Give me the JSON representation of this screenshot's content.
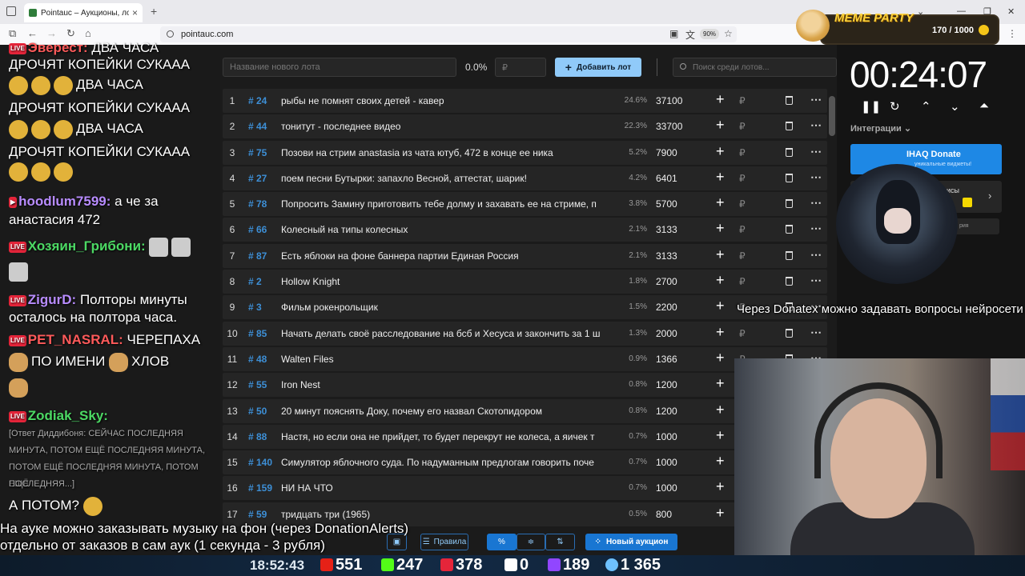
{
  "browser": {
    "tab_title": "Pointauc – Аукционы, лотереи",
    "url": "pointauc.com",
    "zoom": "90%"
  },
  "meme_party": {
    "title": "MEME PARTY",
    "count": "170 / 1000"
  },
  "chat": {
    "messages": [
      {
        "user": "Эверест:",
        "text": "ДВА ЧАСА"
      },
      {
        "text": "ДРОЧЯТ КОПЕЙКИ СУКААА"
      },
      {
        "text": "ДВА ЧАСА"
      },
      {
        "text": "ДРОЧЯТ КОПЕЙКИ СУКААА"
      },
      {
        "text": "ДВА ЧАСА"
      },
      {
        "text": "ДРОЧЯТ КОПЕЙКИ СУКААА"
      },
      {
        "user": "hoodlum7599:",
        "text": "а че за"
      },
      {
        "text": "анастасия 472"
      },
      {
        "user": "Хозяин_Грибони:"
      },
      {
        "user": "ZigurD:",
        "text": "Полторы минуты"
      },
      {
        "text": "осталось на полтора часа."
      },
      {
        "user": "PET_NASRAL:",
        "text": "ЧЕРЕПАХА"
      },
      {
        "text": "ПО ИМЕНИ"
      },
      {
        "text": "ХЛОВ"
      },
      {
        "user": "Zodiak_Sky:"
      },
      {
        "text": "[Ответ Диддибоня: СЕЙЧАС ПОСЛЕДНЯЯ"
      },
      {
        "text": "МИНУТА, ПОТОМ ЕЩЁ ПОСЛЕДНЯЯ МИНУТА,"
      },
      {
        "text": "ПОТОМ ЕЩЁ ПОСЛЕДНЯЯ МИНУТА, ПОТОМ ЕЩЁ"
      },
      {
        "text": "ПОСЛЕДНЯЯ...]"
      },
      {
        "text": "А ПОТОМ?"
      }
    ]
  },
  "auction": {
    "new_lot_placeholder": "Название нового лота",
    "percent": "0.0%",
    "rub_placeholder": "₽",
    "add_label": "Добавить лот",
    "search_placeholder": "Поиск среди лотов...",
    "lots": [
      {
        "n": "1",
        "id": "# 24",
        "name": "рыбы не помнят своих детей - кавер",
        "pct": "24.6%",
        "amount": "37100"
      },
      {
        "n": "2",
        "id": "# 44",
        "name": "тонитут - последнее видео",
        "pct": "22.3%",
        "amount": "33700"
      },
      {
        "n": "3",
        "id": "# 75",
        "name": "Позови на стрим anastasia из чата ютуб, 472 в конце ее ника",
        "pct": "5.2%",
        "amount": "7900"
      },
      {
        "n": "4",
        "id": "# 27",
        "name": "поем песни Бутырки: запахло Весной, аттестат, шарик!",
        "pct": "4.2%",
        "amount": "6401"
      },
      {
        "n": "5",
        "id": "# 78",
        "name": "Попросить Замину приготовить тебе долму и захавать ее на стриме, п",
        "pct": "3.8%",
        "amount": "5700"
      },
      {
        "n": "6",
        "id": "# 66",
        "name": "Колесный на типы колесных",
        "pct": "2.1%",
        "amount": "3133"
      },
      {
        "n": "7",
        "id": "# 87",
        "name": "Есть яблоки на фоне баннера партии Единая Россия",
        "pct": "2.1%",
        "amount": "3133"
      },
      {
        "n": "8",
        "id": "# 2",
        "name": "Hollow Knight",
        "pct": "1.8%",
        "amount": "2700"
      },
      {
        "n": "9",
        "id": "# 3",
        "name": "Фильм рокенрольщик",
        "pct": "1.5%",
        "amount": "2200"
      },
      {
        "n": "10",
        "id": "# 85",
        "name": "Начать делать своё расследование на бсб и Хесуса и закончить за 1 ш",
        "pct": "1.3%",
        "amount": "2000"
      },
      {
        "n": "11",
        "id": "# 48",
        "name": "Walten Files",
        "pct": "0.9%",
        "amount": "1366"
      },
      {
        "n": "12",
        "id": "# 55",
        "name": "Iron Nest",
        "pct": "0.8%",
        "amount": "1200"
      },
      {
        "n": "13",
        "id": "# 50",
        "name": "20 минут пояснять Доку, почему его назвал Скотопидором",
        "pct": "0.8%",
        "amount": "1200"
      },
      {
        "n": "14",
        "id": "# 88",
        "name": "Настя, но если она не прийдет, то будет перекрут не колеса, а яичек т",
        "pct": "0.7%",
        "amount": "1000"
      },
      {
        "n": "15",
        "id": "# 140",
        "name": "Симулятор яблочного суда. По надуманным предлогам говорить поче",
        "pct": "0.7%",
        "amount": "1000"
      },
      {
        "n": "16",
        "id": "# 159",
        "name": "НИ НА ЧТО",
        "pct": "0.7%",
        "amount": "1000"
      },
      {
        "n": "17",
        "id": "# 59",
        "name": "тридцать три (1965)",
        "pct": "0.5%",
        "amount": "800"
      }
    ],
    "rules_label": "Правила",
    "new_auction_label": "Новый аукцион"
  },
  "timer": {
    "time": "00:24:07",
    "integrations_label": "Интеграции",
    "donate_title": "IHAQ Donate",
    "donate_sub": "уникальные виджеты!",
    "card2_title": "исы",
    "card3_text": "рия"
  },
  "captions": {
    "right": "Через Donatex можно задавать вопросы нейросети",
    "bottom_line1": "На ауке можно заказывать музыку на фон (через DonationAlerts)",
    "bottom_line2": "отдельно от заказов в сам аук (1 секунда - 3 рубля)"
  },
  "stats": {
    "clock": "18:52:43",
    "youtube": "551",
    "kick": "247",
    "vk": "378",
    "rutube": "0",
    "twitch": "189",
    "total": "1 365"
  },
  "colors": {
    "accent": "#1976d2",
    "add_button": "#90caf9",
    "lot_id": "#3d8fd6",
    "live_badge": "#e5253a"
  }
}
